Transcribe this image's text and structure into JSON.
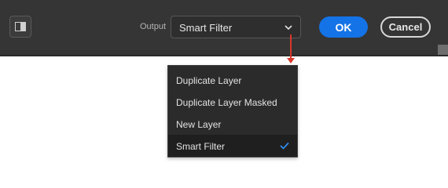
{
  "toolbar": {
    "output_label": "Output",
    "output_value": "Smart Filter",
    "ok_label": "OK",
    "cancel_label": "Cancel"
  },
  "dropdown": {
    "items": [
      {
        "label": "Duplicate Layer",
        "selected": false
      },
      {
        "label": "Duplicate Layer Masked",
        "selected": false
      },
      {
        "label": "New Layer",
        "selected": false
      },
      {
        "label": "Smart Filter",
        "selected": true
      }
    ]
  },
  "colors": {
    "toolbar_bg": "#353535",
    "accent_blue": "#1473e6",
    "callout_red": "#d9372b",
    "menu_bg": "#2b2b2b",
    "check_blue": "#2d8ceb"
  },
  "icons": {
    "panel": "panel-toggle-icon",
    "chevron": "chevron-down-icon",
    "check": "checkmark-icon"
  }
}
